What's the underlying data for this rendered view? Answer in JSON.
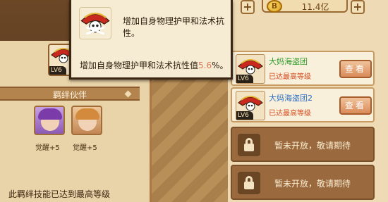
{
  "currency": {
    "amount": "11.4亿",
    "coin_symbol": "B",
    "plus_left": "+",
    "plus_right": "+"
  },
  "tooltip": {
    "title": "增加自身物理护甲和法术抗性。",
    "desc_prefix": "增加自身物理护甲和法术抗性值",
    "desc_value": "5.6",
    "desc_suffix": "%。",
    "value_color": "#e07a5a"
  },
  "left_skill": {
    "level": "LV6",
    "icon": "pirate-flag-icon"
  },
  "bond": {
    "header": "羁绊伙伴",
    "partners": [
      {
        "label": "觉醒+5",
        "icon": "purple-hair-partner-portrait"
      },
      {
        "label": "觉醒+5",
        "icon": "orange-hair-partner-portrait"
      }
    ],
    "footer": "此羁绊技能已达到最高等级"
  },
  "skills": [
    {
      "name": "大妈海盗团",
      "name_color": "#2e9a2a",
      "status": "已达最高等级",
      "level": "LV6",
      "button": "查看"
    },
    {
      "name": "大妈海盗团2",
      "name_color": "#2b6fc9",
      "status": "已达最高等级",
      "level": "LV6",
      "button": "查看"
    }
  ],
  "locked_slots": [
    {
      "text": "暂未开放，敬请期待"
    },
    {
      "text": "暂未开放，敬请期待"
    }
  ]
}
